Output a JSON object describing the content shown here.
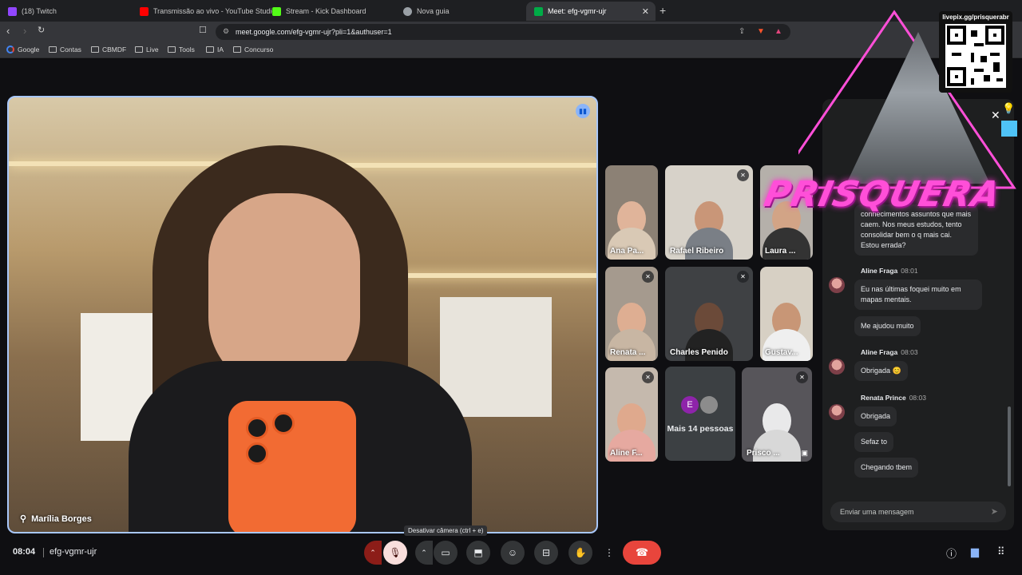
{
  "browser": {
    "tabs": [
      {
        "label": "(18) Twitch",
        "color": "#9146ff"
      },
      {
        "label": "Transmissão ao vivo - YouTube Studio",
        "color": "#ff0000"
      },
      {
        "label": "Stream - Kick Dashboard",
        "color": "#53fc18"
      },
      {
        "label": "Nova guia",
        "color": "#9aa0a6"
      },
      {
        "label": "Meet: efg-vgmr-ujr",
        "color": "#00ac47"
      }
    ],
    "url": "meet.google.com/efg-vgmr-ujr?pli=1&authuser=1",
    "bookmarks": [
      "Google",
      "Contas",
      "CBMDF",
      "Live",
      "Tools",
      "IA",
      "Concurso"
    ]
  },
  "meet": {
    "main_speaker": "Marília Borges",
    "participants": [
      {
        "name": "Ana Pa...",
        "muted": false
      },
      {
        "name": "Rafael Ribeiro",
        "muted": true
      },
      {
        "name": "Laura ...",
        "muted": false
      },
      {
        "name": "Renata ...",
        "muted": true
      },
      {
        "name": "Charles Penido",
        "muted": true
      },
      {
        "name": "Gustav...",
        "muted": false
      },
      {
        "name": "Aline F...",
        "muted": true
      },
      {
        "name": "Prisco ...",
        "muted": true
      }
    ],
    "more_people": {
      "avatar_letter": "E",
      "label": "Mais 14 pessoas"
    },
    "clock": "08:04",
    "meeting_code": "efg-vgmr-ujr",
    "tooltip": "Desativar câmera (ctrl + e)"
  },
  "chat": {
    "partial_message": "conhecimentos assuntos que mais caem. Nos meus estudos, tento consolidar bem o q mais cai. Estou errada?",
    "groups": [
      {
        "sender": "Aline Fraga",
        "time": "08:01",
        "messages": [
          "Eu nas últimas foquei muito em mapas mentais.",
          "Me ajudou muito"
        ]
      },
      {
        "sender": "Aline Fraga",
        "time": "08:03",
        "messages": [
          "Obrigada 😊"
        ]
      },
      {
        "sender": "Renata Prince",
        "time": "08:03",
        "messages": [
          "Obrigada",
          "Sefaz to",
          "Chegando tbem"
        ]
      }
    ],
    "input_placeholder": "Enviar uma mensagem"
  },
  "overlay": {
    "qr_label": "livepix.gg/prisquerabr",
    "brand": "PRISQUERA"
  },
  "colors": {
    "accent": "#a8c7fa",
    "hangup": "#e8453c",
    "brand": "#ff4fd8"
  }
}
